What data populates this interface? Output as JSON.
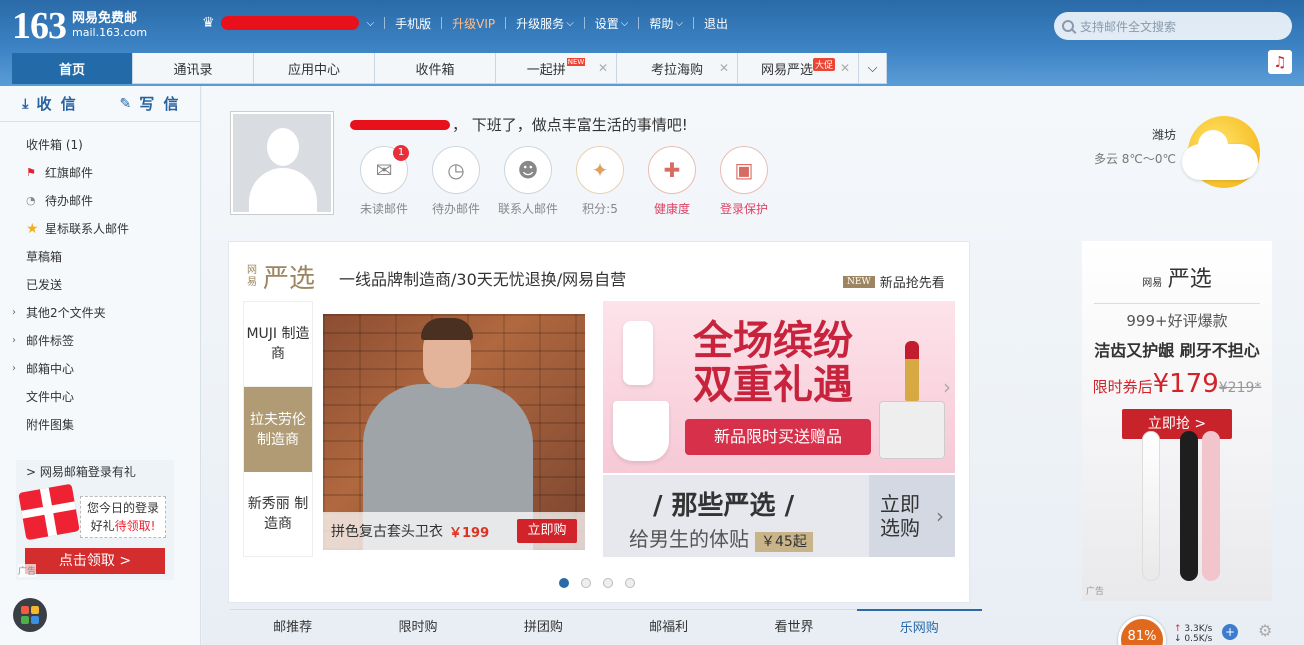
{
  "logo": {
    "number": "163",
    "line1": "网易免费邮",
    "line2": "mail.163.com"
  },
  "topnav": {
    "links": [
      "手机版",
      "升级VIP",
      "升级服务",
      "设置",
      "帮助",
      "退出"
    ],
    "search_placeholder": "支持邮件全文搜索"
  },
  "tabs": [
    {
      "label": "首页"
    },
    {
      "label": "通讯录"
    },
    {
      "label": "应用中心"
    },
    {
      "label": "收件箱"
    },
    {
      "label": "一起拼",
      "tag": "NEW"
    },
    {
      "label": "考拉海购"
    },
    {
      "label": "网易严选",
      "tag": "大促"
    }
  ],
  "sidebar": {
    "receive": "收 信",
    "compose": "写 信",
    "folders": [
      "收件箱 (1)",
      "红旗邮件",
      "待办邮件",
      "星标联系人邮件",
      "草稿箱",
      "已发送",
      "其他2个文件夹",
      "邮件标签",
      "邮箱中心",
      "文件中心",
      "附件图集"
    ],
    "promo": {
      "title": "> 网易邮箱登录有礼",
      "bubble1": "您今日的登录",
      "bubble2a": "好礼",
      "bubble2b": "待领取!",
      "button": "点击领取 >",
      "ad": "广告"
    }
  },
  "home": {
    "greeting": "， 下班了，做点丰富生活的事情吧!",
    "quick": [
      {
        "label": "未读邮件",
        "badge": "1",
        "icon": "mail-icon"
      },
      {
        "label": "待办邮件",
        "icon": "clock-icon"
      },
      {
        "label": "联系人邮件",
        "icon": "contact-star-icon"
      },
      {
        "label": "积分:5",
        "icon": "points-icon"
      },
      {
        "label": "健康度",
        "icon": "health-kit-icon"
      },
      {
        "label": "登录保护",
        "icon": "lock-icon"
      }
    ],
    "weather": {
      "city": "潍坊",
      "condition": "多云 8℃～0℃"
    }
  },
  "yanxuan": {
    "brand_small": "网易",
    "brand_big": "严选",
    "slogan": "一线品牌制造商/30天无忧退换/网易自营",
    "new_tag": "NEW",
    "new_label": "新品抢先看",
    "makers": [
      "MUJI 制造商",
      "拉夫劳伦 制造商",
      "新秀丽 制造商"
    ],
    "hero1": {
      "title": "拼色复古套头卫衣",
      "price": "￥199",
      "button": "立即购"
    },
    "hero2": {
      "line1": "全场缤纷",
      "line2": "双重礼遇",
      "button": "新品限时买送赠品"
    },
    "hero3": {
      "line1": "/ 那些严选 /",
      "line2": "给男生的体贴",
      "price": "￥45起",
      "cta": "立即选购"
    }
  },
  "right_ad": {
    "brand_small": "网易",
    "brand_big": "严选",
    "t1": "999+好评爆款",
    "t2": "洁齿又护龈 刷牙不担心",
    "t3": "限时券后",
    "price": "¥179",
    "orig": "¥219*",
    "button": "立即抢 >",
    "note": "广告"
  },
  "bottom_tabs": [
    "邮推荐",
    "限时购",
    "拼团购",
    "邮福利",
    "看世界",
    "乐网购"
  ],
  "speed": {
    "percent": "81%",
    "up": "3.3K/s",
    "down": "0.5K/s"
  },
  "colors": {
    "topbar": "#2a6aa8",
    "accent": "#226aa8",
    "red": "#d2232a",
    "yanxuan_gold": "#9c8560"
  }
}
